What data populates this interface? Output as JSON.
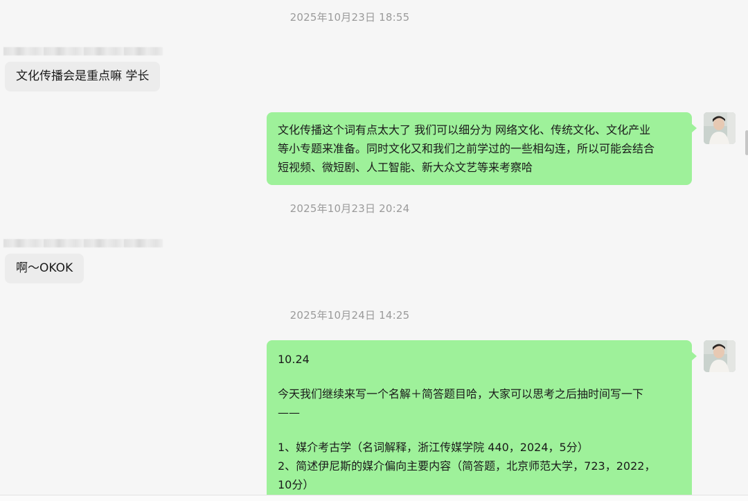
{
  "messages": [
    {
      "type": "timestamp",
      "text": "2025年10月23日 18:55"
    },
    {
      "type": "incoming",
      "text": "文化传播会是重点嘛 学长"
    },
    {
      "type": "outgoing",
      "lines": [
        "文化传播这个词有点太大了 我们可以细分为 网络文化、传统文化、文化产业",
        "等小专题来准备。同时文化又和我们之前学过的一些相勾连，所以可能会结合",
        "短视频、微短剧、人工智能、新大众文艺等来考察哈"
      ]
    },
    {
      "type": "timestamp",
      "text": "2025年10月23日 20:24"
    },
    {
      "type": "incoming",
      "text": "啊～OKOK"
    },
    {
      "type": "timestamp",
      "text": "2025年10月24日 14:25"
    },
    {
      "type": "outgoing",
      "lines": [
        "10.24",
        "",
        "今天我们继续来写一个名解＋简答题目哈，大家可以思考之后抽时间写一下",
        "——",
        "",
        "1、媒介考古学（名词解释，浙江传媒学院 440，2024，5分）",
        "2、简述伊尼斯的媒介偏向主要内容（简答题，北京师范大学，723，2022，",
        "10分）"
      ]
    }
  ],
  "colors": {
    "background": "#f6f6f6",
    "incoming_bubble": "#ececec",
    "outgoing_bubble": "#9ef19a",
    "timestamp_text": "#9a9a9a"
  },
  "avatar": {
    "icon": "user-avatar-photo"
  }
}
